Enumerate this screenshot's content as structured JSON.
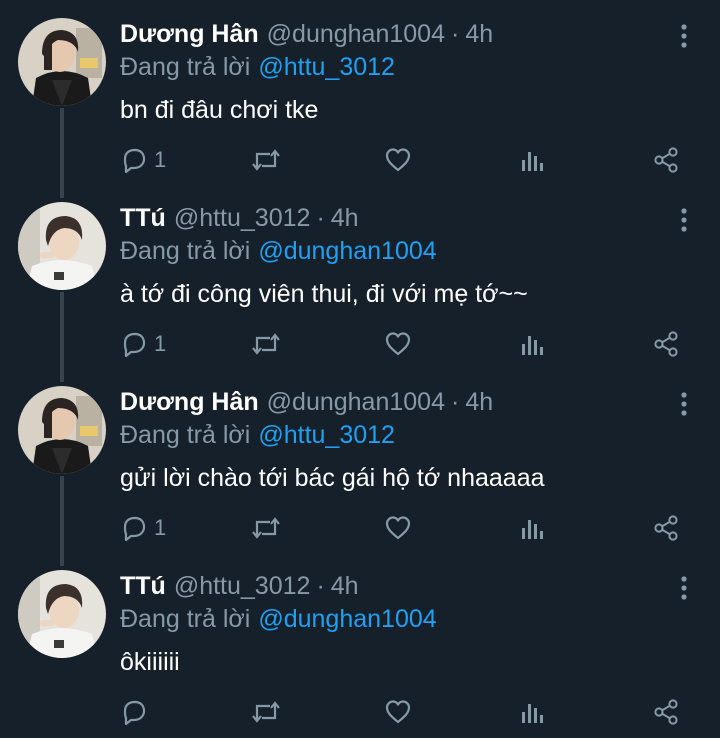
{
  "tweets": [
    {
      "name": "Dương Hân",
      "handle": "@dunghan1004",
      "separator": "·",
      "time": "4h",
      "reply_prefix": "Đang trả lời",
      "reply_target": "@httu_3012",
      "text": "bn đi đâu chơi tke",
      "reply_count": "1",
      "avatar": "avatar-duong-han"
    },
    {
      "name": "TTú",
      "handle": "@httu_3012",
      "separator": "·",
      "time": "4h",
      "reply_prefix": "Đang trả lời",
      "reply_target": "@dunghan1004",
      "text": "à tớ đi công viên thui, đi với mẹ tớ~~",
      "reply_count": "1",
      "avatar": "avatar-ttu"
    },
    {
      "name": "Dương Hân",
      "handle": "@dunghan1004",
      "separator": "·",
      "time": "4h",
      "reply_prefix": "Đang trả lời",
      "reply_target": "@httu_3012",
      "text": "gửi lời chào tới bác gái hộ tớ nhaaaaa",
      "reply_count": "1",
      "avatar": "avatar-duong-han"
    },
    {
      "name": "TTú",
      "handle": "@httu_3012",
      "separator": "·",
      "time": "4h",
      "reply_prefix": "Đang trả lời",
      "reply_target": "@dunghan1004",
      "text": "ôkiiiiii",
      "reply_count": "",
      "avatar": "avatar-ttu"
    }
  ],
  "icons": [
    "more-options-icon",
    "reply-icon",
    "retweet-icon",
    "like-icon",
    "analytics-icon",
    "share-icon"
  ],
  "colors": {
    "background": "#15202b",
    "primary_text": "#ffffff",
    "secondary_text": "#8899a6",
    "link": "#1da1f2",
    "thread_line": "#38444d"
  }
}
